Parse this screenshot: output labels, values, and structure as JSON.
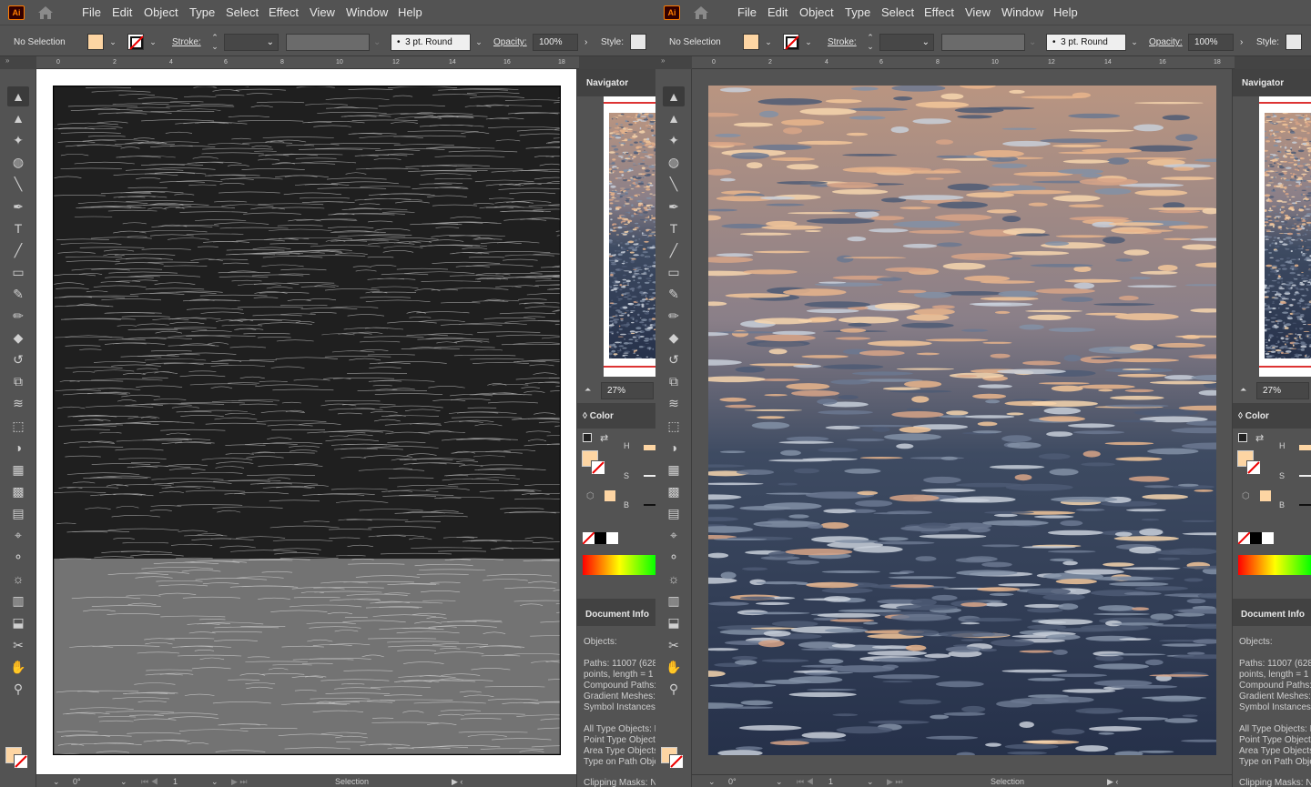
{
  "app": {
    "logo": "Ai"
  },
  "menu": [
    "File",
    "Edit",
    "Object",
    "Type",
    "Select",
    "Effect",
    "View",
    "Window",
    "Help"
  ],
  "control": {
    "selection": "No Selection",
    "stroke_label": "Stroke:",
    "brush": "3 pt. Round",
    "opacity_label": "Opacity:",
    "opacity": "100%",
    "style_label": "Style:"
  },
  "ruler_ticks": [
    "0",
    "2",
    "4",
    "6",
    "8",
    "10",
    "12",
    "14",
    "16",
    "18"
  ],
  "navigator": {
    "title": "Navigator",
    "zoom": "27%"
  },
  "color_panel": {
    "title": "Color",
    "h": "H",
    "s": "S",
    "b": "B"
  },
  "doc_info": {
    "title": "Document Info",
    "objects_label": "Objects:",
    "lines": [
      "Paths: 11007 (628",
      "points, length = 1",
      "Compound Paths:",
      "Gradient Meshes:",
      "Symbol Instances:"
    ],
    "lines2": [
      "All Type Objects: N",
      "Point Type Objects",
      "Area Type Objects",
      "Type on Path Obje"
    ],
    "clipping": "Clipping Masks: N"
  },
  "status": {
    "rotation": "0°",
    "artboard": "1",
    "tool": "Selection"
  },
  "panes": [
    {
      "id": "outline",
      "view": "Outline preview (black strokes on white)"
    },
    {
      "id": "preview",
      "view": "Color preview (vectorized water at sunset)"
    }
  ],
  "colors": {
    "fill": "#fdd5a3",
    "accent": "#ff7c00",
    "ui_bg": "#535353"
  }
}
